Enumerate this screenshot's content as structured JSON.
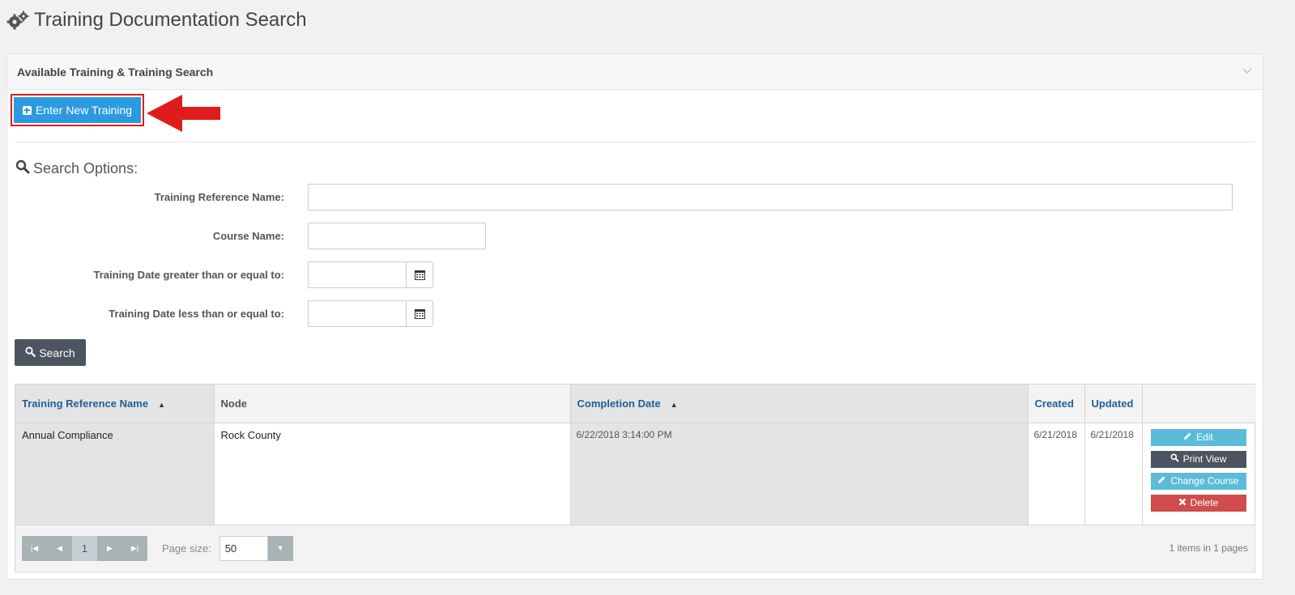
{
  "page": {
    "title": "Training Documentation Search"
  },
  "panel": {
    "heading": "Available Training & Training Search"
  },
  "toolbar": {
    "enter_new_label": "Enter New Training"
  },
  "search": {
    "title": "Search Options:",
    "fields": {
      "reference_name_label": "Training Reference Name:",
      "course_name_label": "Course Name:",
      "date_from_label": "Training Date greater than or equal to:",
      "date_to_label": "Training Date less than or equal to:"
    },
    "button_label": "Search"
  },
  "grid": {
    "columns": {
      "reference_name": "Training Reference Name",
      "node": "Node",
      "completion_date": "Completion Date",
      "created": "Created",
      "updated": "Updated"
    },
    "rows": [
      {
        "reference_name": "Annual Compliance",
        "node": "Rock County",
        "completion_date": "6/22/2018 3:14:00 PM",
        "created": "6/21/2018",
        "updated": "6/21/2018"
      }
    ],
    "actions": {
      "edit": "Edit",
      "print_view": "Print View",
      "change_course": "Change Course",
      "delete": "Delete"
    },
    "pager": {
      "current_page": "1",
      "page_size_label": "Page size:",
      "page_size": "50",
      "info": "1 items in 1 pages"
    }
  },
  "colors": {
    "primary": "#2c9ae0",
    "dark": "#4b5460",
    "info": "#5bbcd9",
    "danger": "#d14c4c",
    "link": "#1f5f96",
    "annotation": "#e01b1b"
  }
}
